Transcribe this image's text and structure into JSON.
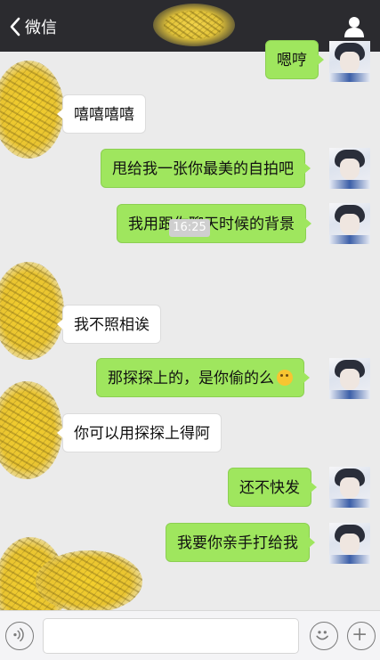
{
  "header": {
    "back_label": "微信",
    "contact_name": ""
  },
  "messages": [
    {
      "side": "me",
      "text": "嗯哼"
    },
    {
      "side": "them",
      "text": "嘻嘻嘻嘻"
    },
    {
      "side": "me",
      "text": "甩给我一张你最美的自拍吧"
    },
    {
      "side": "me",
      "text": "我用跟你聊天时候的背景"
    },
    {
      "side": "time",
      "text": "16:25"
    },
    {
      "side": "them",
      "text": "我不照相诶"
    },
    {
      "side": "me",
      "text": "那探探上的，是你偷的么",
      "emoji": "thinking-face-emoji"
    },
    {
      "side": "them",
      "text": "你可以用探探上得阿"
    },
    {
      "side": "me",
      "text": "还不快发"
    },
    {
      "side": "me",
      "text": "我要你亲手打给我"
    }
  ],
  "input_bar": {
    "placeholder": "",
    "icons": [
      "voice-icon",
      "emoji-icon",
      "plus-icon"
    ]
  },
  "colors": {
    "header_bg": "#2b2b2f",
    "chat_bg": "#ebebeb",
    "my_bubble": "#9fe65e",
    "their_bubble": "#ffffff"
  }
}
